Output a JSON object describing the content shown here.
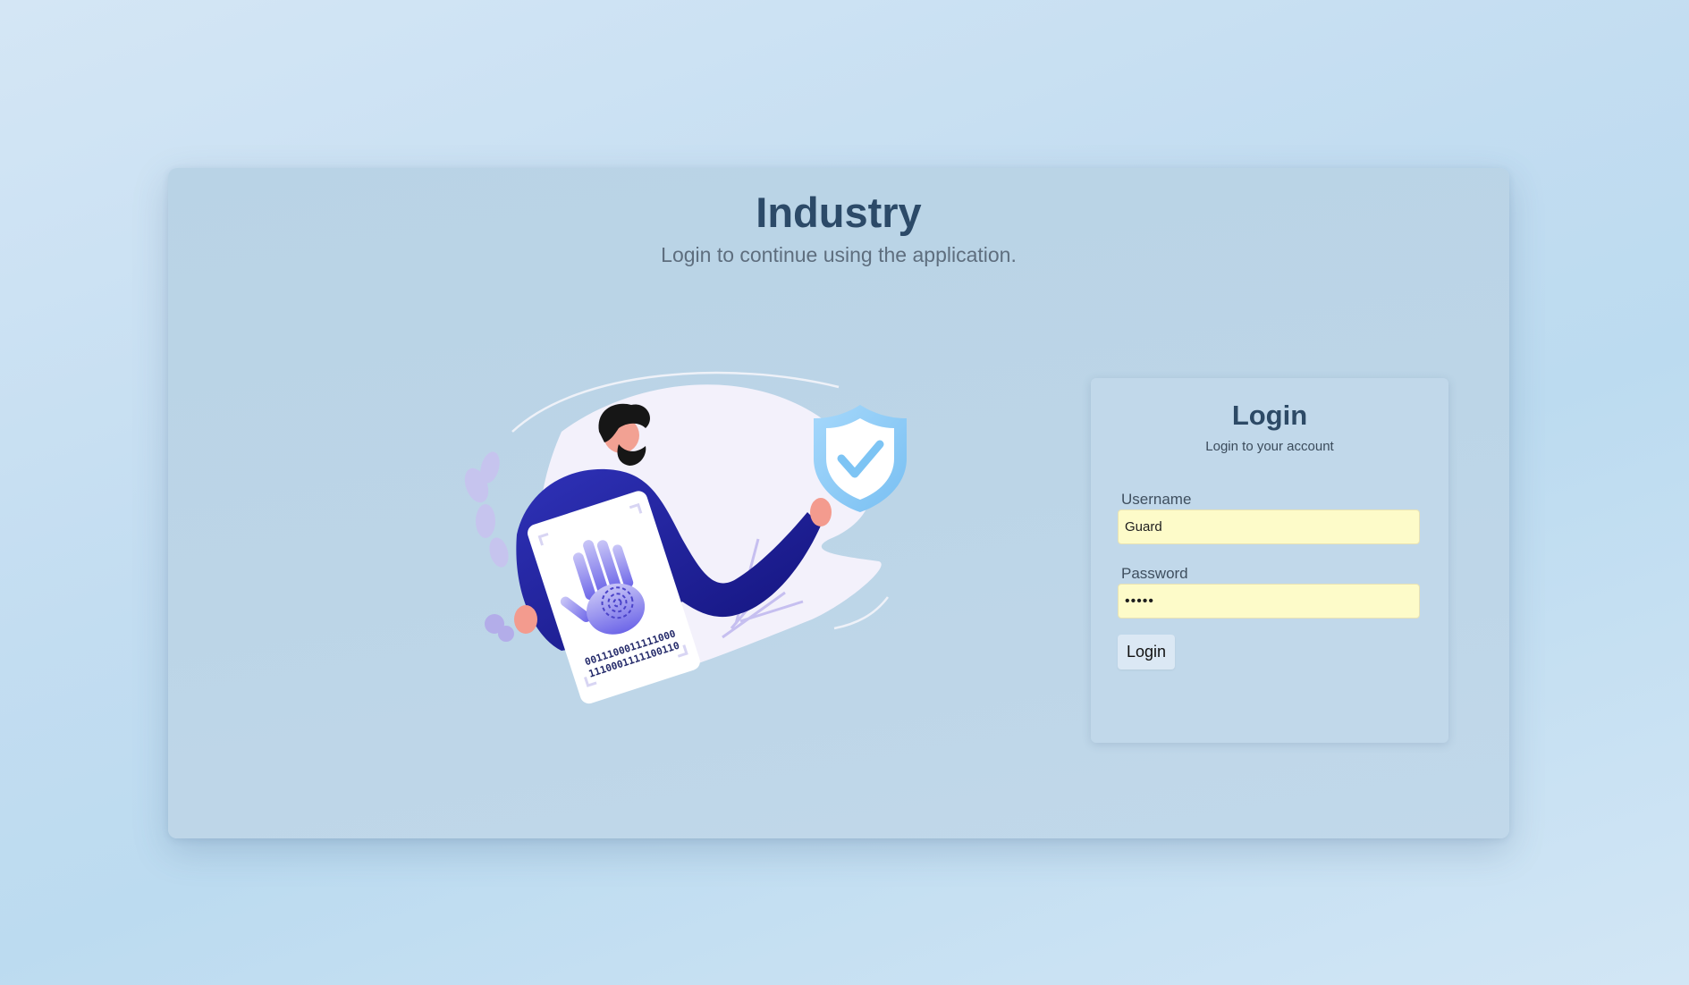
{
  "header": {
    "title": "Industry",
    "subtitle": "Login to continue using the application."
  },
  "illustration": {
    "icon_name": "biometric-security-illustration",
    "binary_line_1": "0011100011111000",
    "binary_line_2": "1110001111100110"
  },
  "login": {
    "title": "Login",
    "subtitle": "Login to your account",
    "username_label": "Username",
    "username_value": "Guard",
    "password_label": "Password",
    "password_value": "•••••",
    "button_label": "Login"
  },
  "colors": {
    "title": "#2c4a68",
    "input_background": "#fdfbc9",
    "shield": "#8dcaf5",
    "jacket": "#2a2a9e"
  }
}
